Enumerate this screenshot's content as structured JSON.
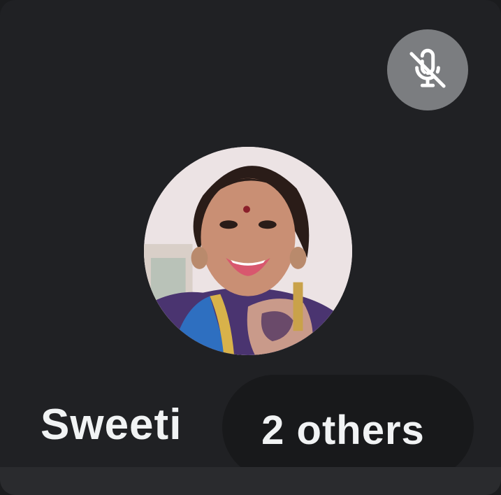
{
  "participant": {
    "name": "Sweeti",
    "muted_icon": "mic-off-icon",
    "avatar": "profile-photo"
  },
  "others_chip": {
    "label": "2 others"
  },
  "colors": {
    "tile_background": "#202124",
    "badge_background": "#7b7d80",
    "text": "#f1f3f4"
  }
}
